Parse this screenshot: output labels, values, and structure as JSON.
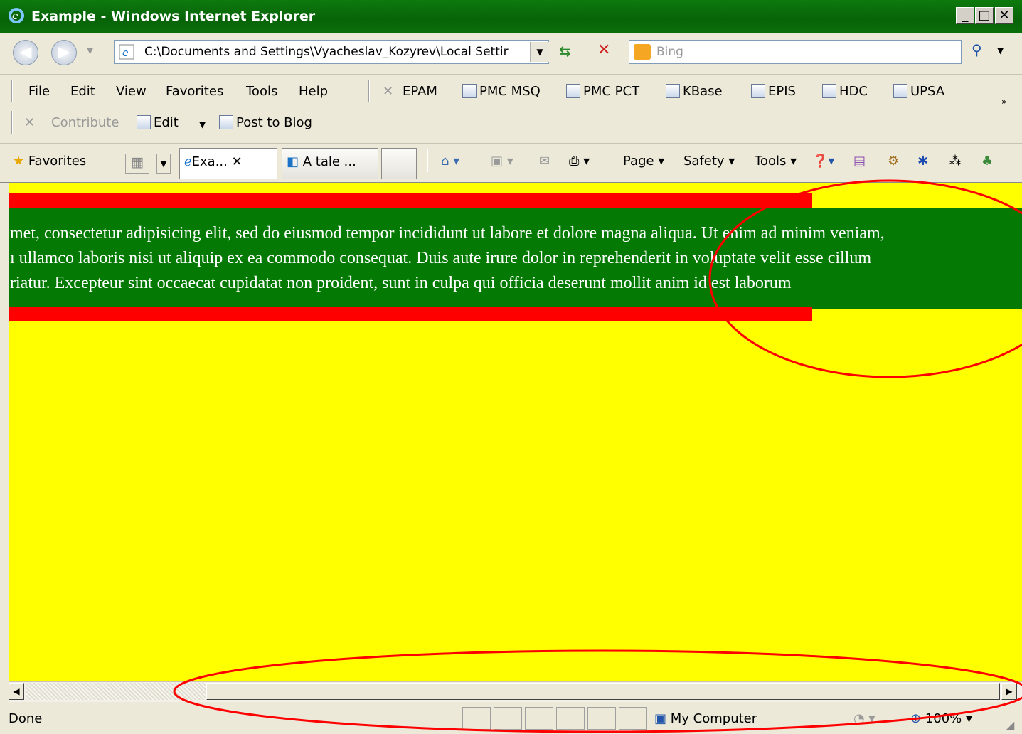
{
  "window": {
    "title": "Example - Windows Internet Explorer",
    "controls": [
      "_",
      "□",
      "X"
    ]
  },
  "address_bar": {
    "url": "C:\\Documents and Settings\\Vyacheslav_Kozyrev\\Local Settir",
    "search_placeholder": "Bing"
  },
  "menu": [
    "File",
    "Edit",
    "View",
    "Favorites",
    "Tools",
    "Help"
  ],
  "links": [
    "EPAM",
    "PMC MSQ",
    "PMC PCT",
    "KBase",
    "EPIS",
    "HDC",
    "UPSA"
  ],
  "links_row2": {
    "contribute": "Contribute",
    "edit": "Edit",
    "post": "Post to Blog"
  },
  "favorites_label": "Favorites",
  "tabs": [
    {
      "label": "Exa...",
      "active": true
    },
    {
      "label": "A tale ...",
      "active": false
    }
  ],
  "commands": {
    "page": "Page ▾",
    "safety": "Safety ▾",
    "tools": "Tools ▾"
  },
  "content": {
    "background": "#ffff00",
    "band_color": "#047a04",
    "stripe_color": "#ff0000",
    "lines": [
      "met, consectetur adipisicing elit, sed do eiusmod tempor incididunt ut labore et dolore magna aliqua. Ut enim ad minim veniam,",
      "ı ullamco laboris nisi ut aliquip ex ea commodo consequat. Duis aute irure dolor in reprehenderit in voluptate velit esse cillum",
      "riatur. Excepteur sint occaecat cupidatat non proident, sunt in culpa qui officia deserunt mollit anim id est laborum"
    ]
  },
  "status": {
    "text": "Done",
    "zone": "My Computer",
    "zoom": "100%"
  },
  "annotation_color": "#ff0000"
}
